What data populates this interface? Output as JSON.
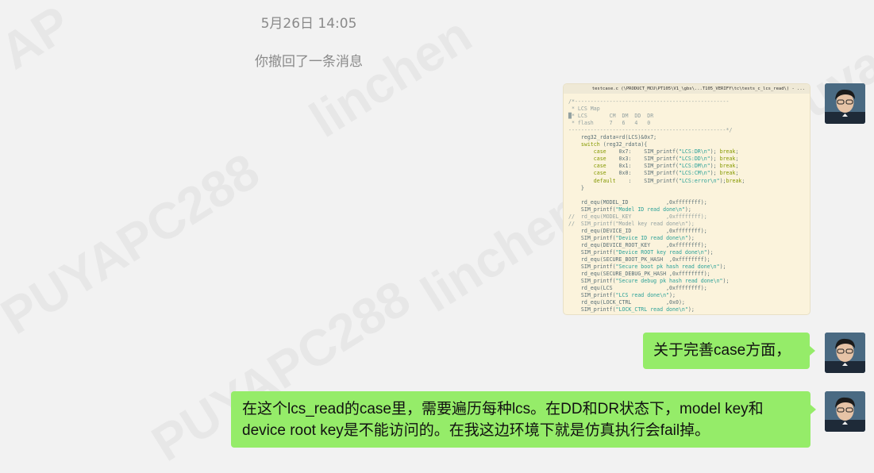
{
  "chat": {
    "timestamp": "5月26日 14:05",
    "recall_notice": "你撤回了一条消息",
    "messages": [
      {
        "type": "image",
        "title": "testcase.c (\\PRODUCT_MCU\\PT105\\V1_\\gbs\\...T105_VERIFY\\tc\\tests_c_lcs_read\\) - ..."
      },
      {
        "type": "text",
        "text": "关于完善case方面，"
      },
      {
        "type": "text",
        "text": "在这个lcs_read的case里，需要遍历每种lcs。在DD和DR状态下，model key和device root key是不能访问的。在我这边环境下就是仿真执行会fail掉。"
      }
    ]
  },
  "watermarks": [
    "PUYAPC288",
    "linchen",
    "PUYAPC288",
    "linchen",
    "Puya C",
    "AP"
  ],
  "colors": {
    "bubble": "#95ec69",
    "background": "#f2f2f2",
    "meta_text": "#8a8a8a"
  }
}
